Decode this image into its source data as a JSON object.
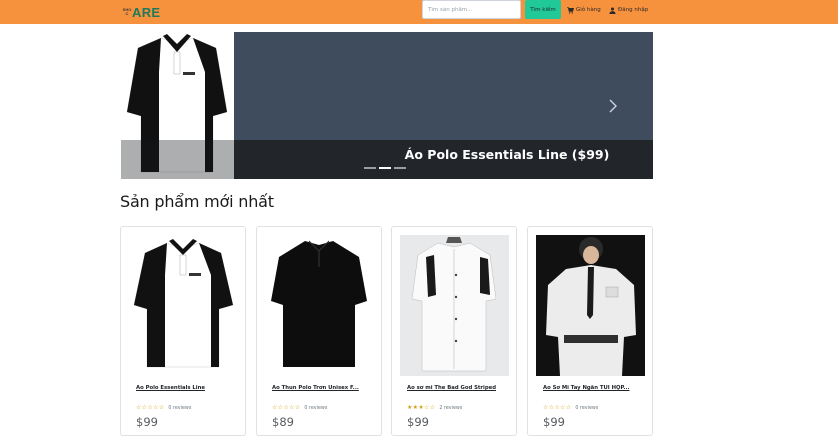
{
  "navbar": {
    "logo_small": "SHO\nC",
    "logo_big": "ARE",
    "search_placeholder": "Tìm sản phẩm...",
    "search_button": "Tìm kiếm",
    "cart_label": "Giỏ hàng",
    "login_label": "Đăng nhập",
    "bg_color": "#f6913e"
  },
  "carousel": {
    "caption": "Áo Polo Essentials Line ($99)",
    "slide_count": 3,
    "active_index": 1
  },
  "section": {
    "title": "Sản phẩm mới nhất"
  },
  "products": [
    {
      "name": "Áo Polo Essentials Line",
      "rating": 0,
      "reviews": "0 reviews",
      "price": "$99"
    },
    {
      "name": "Áo Thun Polo Trơn Unisex F...",
      "rating": 0,
      "reviews": "0 reviews",
      "price": "$89"
    },
    {
      "name": "Áo sơ mi The Bad God Striped",
      "rating": 3,
      "reviews": "2 reviews",
      "price": "$99"
    },
    {
      "name": "Áo Sơ Mi Tay Ngắn TÚI HỘP...",
      "rating": 0,
      "reviews": "0 reviews",
      "price": "$99"
    }
  ],
  "icons": {
    "cart": "cart-icon",
    "login": "user-icon",
    "next": "chevron-right-icon",
    "star": "star-icon"
  },
  "colors": {
    "accent": "#20c997",
    "star": "#d4a017"
  }
}
